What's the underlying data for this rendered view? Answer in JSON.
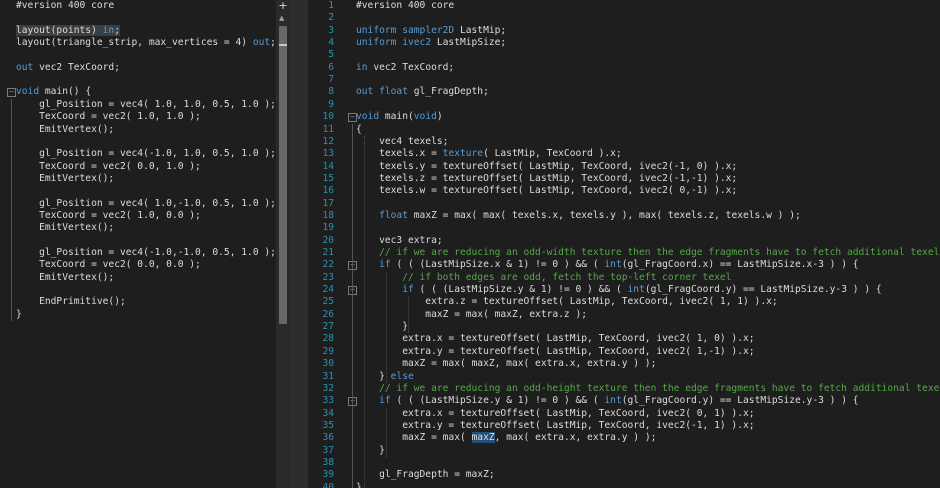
{
  "left_editor": {
    "lines": [
      [
        {
          "t": "#version 400 core",
          "c": "pp"
        }
      ],
      [],
      [
        {
          "t": "layout(points) ",
          "c": "hl"
        },
        {
          "t": "in",
          "c": "kw hl"
        },
        {
          "t": ";",
          "c": "hl"
        }
      ],
      [
        {
          "t": "layout(triangle_strip, max_vertices = 4) "
        },
        {
          "t": "out",
          "c": "kw"
        },
        {
          "t": ";"
        }
      ],
      [],
      [
        {
          "t": "out",
          "c": "kw"
        },
        {
          "t": " vec2 TexCoord;"
        }
      ],
      [],
      [
        {
          "t": "void",
          "c": "kw"
        },
        {
          "t": " main() {"
        }
      ],
      [
        {
          "t": "    gl_Position = vec4( 1.0, 1.0, 0.5, 1.0 );"
        }
      ],
      [
        {
          "t": "    TexCoord = vec2( 1.0, 1.0 );"
        }
      ],
      [
        {
          "t": "    EmitVertex();"
        }
      ],
      [],
      [
        {
          "t": "    gl_Position = vec4(-1.0, 1.0, 0.5, 1.0 );"
        }
      ],
      [
        {
          "t": "    TexCoord = vec2( 0.0, 1.0 );"
        }
      ],
      [
        {
          "t": "    EmitVertex();"
        }
      ],
      [],
      [
        {
          "t": "    gl_Position = vec4( 1.0,-1.0, 0.5, 1.0 );"
        }
      ],
      [
        {
          "t": "    TexCoord = vec2( 1.0, 0.0 );"
        }
      ],
      [
        {
          "t": "    EmitVertex();"
        }
      ],
      [],
      [
        {
          "t": "    gl_Position = vec4(-1.0,-1.0, 0.5, 1.0 );"
        }
      ],
      [
        {
          "t": "    TexCoord = vec2( 0.0, 0.0 );"
        }
      ],
      [
        {
          "t": "    EmitVertex();"
        }
      ],
      [],
      [
        {
          "t": "    EndPrimitive();"
        }
      ],
      [
        {
          "t": "}"
        }
      ]
    ]
  },
  "right_editor": {
    "lines": [
      {
        "n": "1",
        "s": [
          {
            "t": "#version 400 core"
          }
        ]
      },
      {
        "n": "2",
        "s": []
      },
      {
        "n": "3",
        "s": [
          {
            "t": "uniform",
            "c": "kw"
          },
          {
            "t": " "
          },
          {
            "t": "sampler2D",
            "c": "kw"
          },
          {
            "t": " LastMip;"
          }
        ]
      },
      {
        "n": "4",
        "s": [
          {
            "t": "uniform",
            "c": "kw"
          },
          {
            "t": " "
          },
          {
            "t": "ivec2",
            "c": "kw"
          },
          {
            "t": " LastMipSize;"
          }
        ]
      },
      {
        "n": "5",
        "s": []
      },
      {
        "n": "6",
        "s": [
          {
            "t": "in",
            "c": "kw"
          },
          {
            "t": " vec2 TexCoord;"
          }
        ]
      },
      {
        "n": "7",
        "s": []
      },
      {
        "n": "8",
        "s": [
          {
            "t": "out",
            "c": "kw"
          },
          {
            "t": " "
          },
          {
            "t": "float",
            "c": "kw"
          },
          {
            "t": " gl_FragDepth;"
          }
        ]
      },
      {
        "n": "9",
        "s": []
      },
      {
        "n": "10",
        "s": [
          {
            "t": "void",
            "c": "kw"
          },
          {
            "t": " main("
          },
          {
            "t": "void",
            "c": "kw"
          },
          {
            "t": ")"
          }
        ]
      },
      {
        "n": "11",
        "s": [
          {
            "t": "{"
          }
        ]
      },
      {
        "n": "12",
        "s": [
          {
            "t": "    vec4 texels;"
          }
        ]
      },
      {
        "n": "13",
        "s": [
          {
            "t": "    texels.x = "
          },
          {
            "t": "texture",
            "c": "fn"
          },
          {
            "t": "( LastMip, TexCoord ).x;"
          }
        ]
      },
      {
        "n": "14",
        "s": [
          {
            "t": "    texels.y = textureOffset( LastMip, TexCoord, ivec2(-1, 0) ).x;"
          }
        ]
      },
      {
        "n": "15",
        "s": [
          {
            "t": "    texels.z = textureOffset( LastMip, TexCoord, ivec2(-1,-1) ).x;"
          }
        ]
      },
      {
        "n": "16",
        "s": [
          {
            "t": "    texels.w = textureOffset( LastMip, TexCoord, ivec2( 0,-1) ).x;"
          }
        ]
      },
      {
        "n": "17",
        "s": []
      },
      {
        "n": "18",
        "s": [
          {
            "t": "    "
          },
          {
            "t": "float",
            "c": "kw"
          },
          {
            "t": " maxZ = max( max( texels.x, texels.y ), max( texels.z, texels.w ) );"
          }
        ]
      },
      {
        "n": "19",
        "s": []
      },
      {
        "n": "20",
        "s": [
          {
            "t": "    vec3 extra;"
          }
        ]
      },
      {
        "n": "21",
        "s": [
          {
            "t": "    // if we are reducing an odd-width texture then the edge fragments have to fetch additional texels",
            "c": "cm"
          }
        ]
      },
      {
        "n": "22",
        "s": [
          {
            "t": "    "
          },
          {
            "t": "if",
            "c": "kw"
          },
          {
            "t": " ( ( (LastMipSize.x & 1) != 0 ) && ( "
          },
          {
            "t": "int",
            "c": "kw"
          },
          {
            "t": "(gl_FragCoord.x) == LastMipSize.x-3 ) ) {"
          }
        ]
      },
      {
        "n": "23",
        "s": [
          {
            "t": "        // if both edges are odd, fetch the top-left corner texel",
            "c": "cm"
          }
        ]
      },
      {
        "n": "24",
        "s": [
          {
            "t": "        "
          },
          {
            "t": "if",
            "c": "kw"
          },
          {
            "t": " ( ( (LastMipSize.y & 1) != 0 ) && ( "
          },
          {
            "t": "int",
            "c": "kw"
          },
          {
            "t": "(gl_FragCoord.y) == LastMipSize.y-3 ) ) {"
          }
        ]
      },
      {
        "n": "25",
        "s": [
          {
            "t": "            extra.z = textureOffset( LastMip, TexCoord, ivec2( 1, 1) ).x;"
          }
        ]
      },
      {
        "n": "26",
        "s": [
          {
            "t": "            maxZ = max( maxZ, extra.z );"
          }
        ]
      },
      {
        "n": "27",
        "s": [
          {
            "t": "        }"
          }
        ]
      },
      {
        "n": "28",
        "s": [
          {
            "t": "        extra.x = textureOffset( LastMip, TexCoord, ivec2( 1, 0) ).x;"
          }
        ]
      },
      {
        "n": "29",
        "s": [
          {
            "t": "        extra.y = textureOffset( LastMip, TexCoord, ivec2( 1,-1) ).x;"
          }
        ]
      },
      {
        "n": "30",
        "s": [
          {
            "t": "        maxZ = max( maxZ, max( extra.x, extra.y ) );"
          }
        ]
      },
      {
        "n": "31",
        "s": [
          {
            "t": "    } "
          },
          {
            "t": "else",
            "c": "kw"
          }
        ]
      },
      {
        "n": "32",
        "s": [
          {
            "t": "    // if we are reducing an odd-height texture then the edge fragments have to fetch additional texels",
            "c": "cm"
          }
        ]
      },
      {
        "n": "33",
        "s": [
          {
            "t": "    "
          },
          {
            "t": "if",
            "c": "kw"
          },
          {
            "t": " ( ( (LastMipSize.y & 1) != 0 ) && ( "
          },
          {
            "t": "int",
            "c": "kw"
          },
          {
            "t": "(gl_FragCoord.y) == LastMipSize.y-3 ) ) {"
          }
        ]
      },
      {
        "n": "34",
        "s": [
          {
            "t": "        extra.x = textureOffset( LastMip, TexCoord, ivec2( 0, 1) ).x;"
          }
        ]
      },
      {
        "n": "35",
        "s": [
          {
            "t": "        extra.y = textureOffset( LastMip, TexCoord, ivec2(-1, 1) ).x;"
          }
        ]
      },
      {
        "n": "36",
        "s": [
          {
            "t": "        maxZ = max( "
          },
          {
            "t": "maxZ",
            "c": "sel"
          },
          {
            "t": ", max( extra.x, extra.y ) );"
          }
        ]
      },
      {
        "n": "37",
        "s": [
          {
            "t": "    }"
          }
        ]
      },
      {
        "n": "38",
        "s": []
      },
      {
        "n": "39",
        "s": [
          {
            "t": "    gl_FragDepth = maxZ;"
          }
        ]
      },
      {
        "n": "40",
        "s": [
          {
            "t": "}"
          }
        ]
      }
    ]
  },
  "icons": {
    "scroll_add": "+",
    "scroll_up": "▲",
    "fold": "−"
  }
}
